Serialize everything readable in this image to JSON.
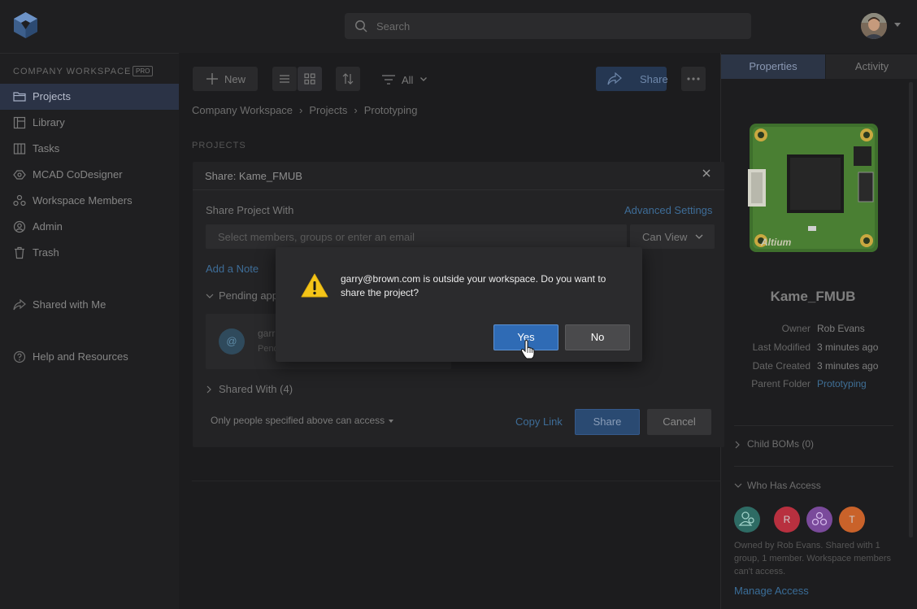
{
  "search": {
    "placeholder": "Search"
  },
  "sidebar": {
    "workspace_title": "COMPANY WORKSPACE",
    "pro_badge": "PRO",
    "items": [
      {
        "label": "Projects",
        "icon": "folder-icon"
      },
      {
        "label": "Library",
        "icon": "library-icon"
      },
      {
        "label": "Tasks",
        "icon": "tasks-icon"
      },
      {
        "label": "MCAD CoDesigner",
        "icon": "mcad-icon"
      },
      {
        "label": "Workspace Members",
        "icon": "members-icon"
      },
      {
        "label": "Admin",
        "icon": "admin-icon"
      },
      {
        "label": "Trash",
        "icon": "trash-icon"
      }
    ],
    "shared_with_me": "Shared with Me",
    "help": "Help and Resources"
  },
  "toolbar": {
    "new_label": "New",
    "filter_label": "All",
    "share_label": "Share"
  },
  "breadcrumb": [
    "Company Workspace",
    "Projects",
    "Prototyping"
  ],
  "main": {
    "section_label": "PROJECTS"
  },
  "right_panel": {
    "tabs": [
      "Properties",
      "Activity"
    ],
    "project_title": "Kame_FMUB",
    "properties": [
      {
        "key": "Owner",
        "value": "Rob Evans"
      },
      {
        "key": "Last Modified",
        "value": "3 minutes ago"
      },
      {
        "key": "Date Created",
        "value": "3 minutes ago"
      },
      {
        "key": "Parent Folder",
        "value": "Prototyping"
      }
    ],
    "child_boms": "Child BOMs (0)",
    "who_has_access": "Who Has Access",
    "access_avatars": [
      {
        "initial": "",
        "color": "#2e6b64"
      },
      {
        "initial": "R",
        "color": "#b8303f"
      },
      {
        "initial": "",
        "color": "#7a4a9b"
      },
      {
        "initial": "T",
        "color": "#c9622a"
      }
    ],
    "access_note": "Owned by Rob Evans. Shared with 1 group, 1 member. Workspace members can't access.",
    "manage_access": "Manage Access"
  },
  "share_dialog": {
    "title": "Share: Kame_FMUB",
    "share_with_label": "Share Project With",
    "advanced_settings": "Advanced Settings",
    "input_placeholder": "Select members, groups or enter an email",
    "permission": "Can View",
    "add_note": "Add a Note",
    "pending_label": "Pending app",
    "pending_user": {
      "initial": "@",
      "name": "garr",
      "status": "Pend"
    },
    "shared_with": "Shared With (4)",
    "access_option": "Only people specified above can access",
    "copy_link": "Copy Link",
    "share_button": "Share",
    "cancel_button": "Cancel"
  },
  "confirm_dialog": {
    "message": "garry@brown.com is outside your workspace. Do you want to share the project?",
    "yes": "Yes",
    "no": "No"
  },
  "colors": {
    "accent": "#2f6bb5",
    "link": "#3e6d98",
    "warning": "#f5c518"
  }
}
